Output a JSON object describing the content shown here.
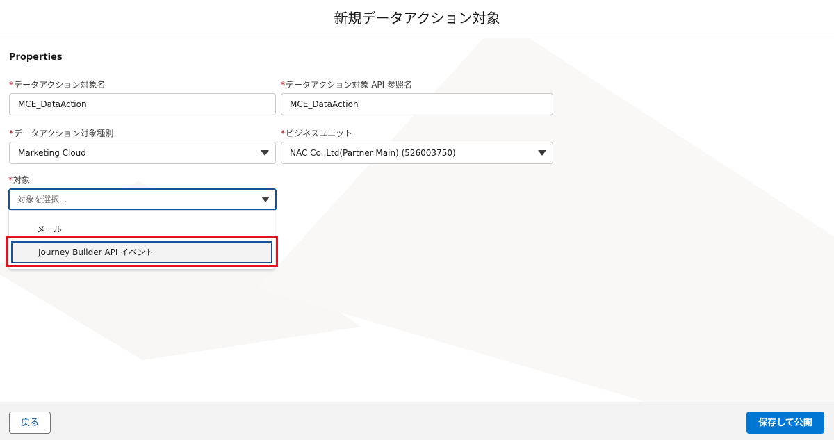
{
  "header": {
    "title": "新規データアクション対象"
  },
  "properties": {
    "section_title": "Properties",
    "required_marker": "*",
    "target_name": {
      "label": "データアクション対象名",
      "value": "MCE_DataAction"
    },
    "api_name": {
      "label": "データアクション対象 API 参照名",
      "value": "MCE_DataAction"
    },
    "target_type": {
      "label": "データアクション対象種別",
      "selected": "Marketing Cloud"
    },
    "business_unit": {
      "label": "ビジネスユニット",
      "selected": "NAC Co.,Ltd(Partner Main) (526003750)"
    },
    "target": {
      "label": "対象",
      "placeholder": "対象を選択...",
      "options": [
        {
          "label": "メール"
        },
        {
          "label": "Journey Builder API イベント"
        }
      ]
    }
  },
  "footer": {
    "back_label": "戻る",
    "save_label": "保存して公開"
  },
  "colors": {
    "brand_blue": "#0176d3",
    "focus_blue": "#1b5297",
    "required_red": "#ba0517",
    "highlight_red": "#e0141e"
  }
}
